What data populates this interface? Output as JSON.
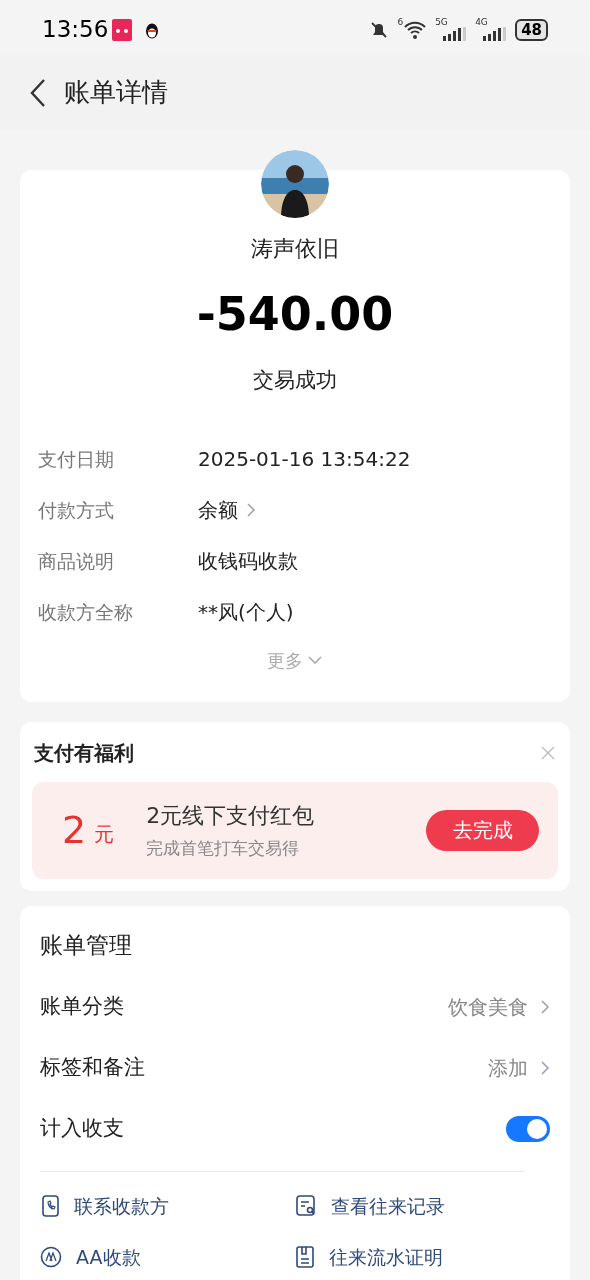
{
  "status_bar": {
    "time": "13:56",
    "wifi_badge": "6",
    "sim1": "5G",
    "sim2": "4G",
    "battery": "48"
  },
  "header": {
    "title": "账单详情"
  },
  "summary": {
    "payee": "涛声依旧",
    "amount": "-540.00",
    "status": "交易成功",
    "details": [
      {
        "label": "支付日期",
        "value": "2025-01-16 13:54:22",
        "kind": "text"
      },
      {
        "label": "付款方式",
        "value": "余额",
        "kind": "link"
      },
      {
        "label": "商品说明",
        "value": "收钱码收款",
        "kind": "text"
      },
      {
        "label": "收款方全称",
        "value": "**风(个人)",
        "kind": "text"
      }
    ],
    "more": "更多"
  },
  "promo": {
    "title": "支付有福利",
    "amount": "2",
    "unit": "元",
    "headline": "2元线下支付红包",
    "subtitle": "完成首笔打车交易得",
    "button": "去完成"
  },
  "management": {
    "title": "账单管理",
    "rows": [
      {
        "label": "账单分类",
        "value": "饮食美食",
        "kind": "link"
      },
      {
        "label": "标签和备注",
        "value": "添加",
        "kind": "link"
      },
      {
        "label": "计入收支",
        "kind": "toggle",
        "on": true
      }
    ],
    "actions": [
      {
        "label": "联系收款方",
        "kind": "phone"
      },
      {
        "label": "查看往来记录",
        "kind": "records"
      },
      {
        "label": "AA收款",
        "kind": "aa"
      },
      {
        "label": "往来流水证明",
        "kind": "proof"
      }
    ]
  }
}
